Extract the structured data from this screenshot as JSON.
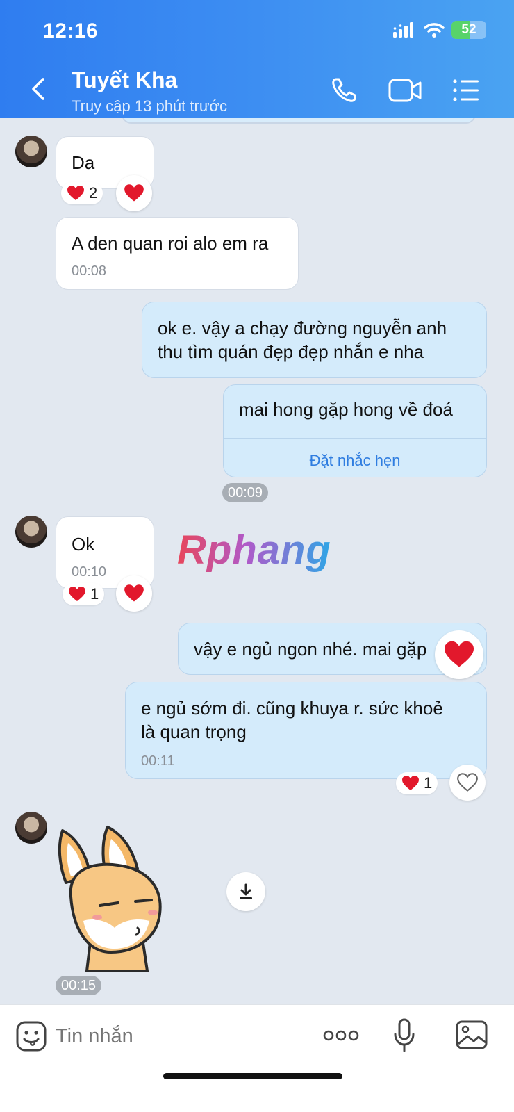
{
  "status_bar": {
    "time": "12:16",
    "battery": "52"
  },
  "header": {
    "contact_name": "Tuyết Kha",
    "last_seen": "Truy cập 13 phút trước"
  },
  "messages": [
    {
      "id": "m1",
      "from": "them",
      "text": "Da",
      "reaction_count": "2"
    },
    {
      "id": "m2",
      "from": "them",
      "text": "A den quan roi alo em ra",
      "time": "00:08"
    },
    {
      "id": "m3",
      "from": "me",
      "text_line1": "ok e. vậy a chạy đường nguyễn anh",
      "text_line2": "thu tìm quán đẹp đẹp nhắn e nha"
    },
    {
      "id": "m4",
      "from": "me",
      "text": "mai hong gặp hong về đoá",
      "action": "Đặt nhắc hẹn",
      "time": "00:09"
    },
    {
      "id": "m5",
      "from": "them",
      "text": "Ok",
      "time": "00:10",
      "reaction_count": "1"
    },
    {
      "id": "m6",
      "from": "me",
      "text": "vậy e ngủ ngon nhé. mai gặp"
    },
    {
      "id": "m7",
      "from": "me",
      "text_line1": "e ngủ sớm đi. cũng khuya r. sức khoẻ",
      "text_line2": "là quan trọng",
      "time": "00:11",
      "reaction_count": "1"
    },
    {
      "id": "m8",
      "from": "them",
      "type": "sticker",
      "time": "00:15"
    }
  ],
  "watermark": "Rphang",
  "composer": {
    "placeholder": "Tin nhắn"
  },
  "colors": {
    "header_start": "#2f7df0",
    "header_end": "#4aa3f2",
    "outgoing_bubble": "#d4ebfb",
    "link": "#2f7de0",
    "heart": "#e2182c"
  },
  "icons": [
    "back-icon",
    "phone-icon",
    "video-call-icon",
    "menu-list-icon",
    "heart-icon",
    "download-icon",
    "emoji-sticker-icon",
    "more-icon",
    "microphone-icon",
    "image-icon"
  ]
}
